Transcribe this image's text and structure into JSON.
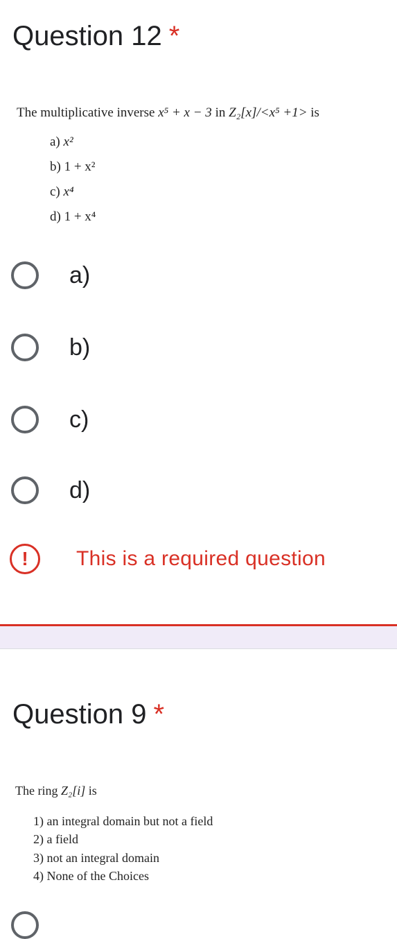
{
  "q12": {
    "title": "Question 12",
    "required_mark": "*",
    "stem": {
      "prefix": "The multiplicative inverse ",
      "expr": "x⁵ +  x − 3",
      "mid": " in ",
      "ring": "Z₂[x]/<x⁵ +1>",
      "suffix": " is"
    },
    "choices": [
      {
        "letter": "a)",
        "value": "x²"
      },
      {
        "letter": "b)",
        "value": "1 + x²"
      },
      {
        "letter": "c)",
        "value": "x⁴"
      },
      {
        "letter": "d)",
        "value": "1 + x⁴"
      }
    ],
    "options": [
      "a)",
      "b)",
      "c)",
      "d)"
    ],
    "error": {
      "icon": "!",
      "text": "This is a required question"
    }
  },
  "q9": {
    "title": "Question 9",
    "required_mark": "*",
    "stem": {
      "prefix": "The ring ",
      "ring": "Z₂[i]",
      "suffix": " is"
    },
    "choices": [
      "1)  an integral domain but not a field",
      "2)  a field",
      "3)  not an integral domain",
      "4)  None of the Choices"
    ]
  },
  "colors": {
    "required": "#d93025",
    "ring": "#5f6368",
    "band": "#f0ebf8"
  }
}
